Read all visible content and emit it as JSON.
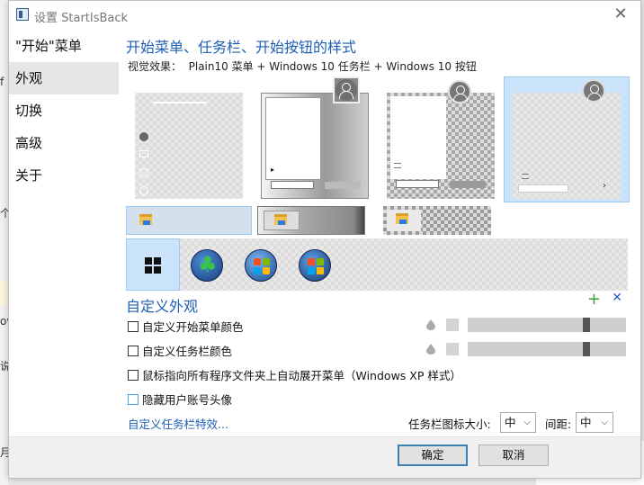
{
  "window": {
    "title": "设置 StartIsBack",
    "close_glyph": "✕"
  },
  "background": {
    "left_fragments": [
      "f",
      "个",
      "ov",
      "说",
      "月"
    ]
  },
  "sidebar": {
    "items": [
      {
        "label": "\"开始\"菜单",
        "active": false
      },
      {
        "label": "外观",
        "active": true
      },
      {
        "label": "切换",
        "active": false
      },
      {
        "label": "高级",
        "active": false
      },
      {
        "label": "关于",
        "active": false
      }
    ]
  },
  "appearance": {
    "heading": "开始菜单、任务栏、开始按钮的样式",
    "visual_effect": "视觉效果：  Plain10 菜单 + Windows 10 任务栏 + Windows 10 按钮",
    "selected_style_index": 3,
    "selected_button_index": 0
  },
  "customize": {
    "heading": "自定义外观",
    "add_icon": "+",
    "remove_icon": "✕",
    "options": [
      {
        "label": "自定义开始菜单颜色",
        "checked": false
      },
      {
        "label": "自定义任务栏颜色",
        "checked": false
      },
      {
        "label": "鼠标指向所有程序文件夹上自动展开菜单（Windows XP 样式）",
        "checked": false
      },
      {
        "label": "隐藏用户账号头像",
        "checked": false
      }
    ],
    "link": "自定义任务栏特效...",
    "icon_size_label": "任务栏图标大小:",
    "icon_size_value": "中",
    "spacing_label": "间距:",
    "spacing_value": "中",
    "chevron": "⌵"
  },
  "footer": {
    "ok": "确定",
    "cancel": "取消"
  },
  "colors": {
    "accent": "#1e5eb6",
    "selected": "#cce4fb",
    "plus": "#3aa13a"
  }
}
